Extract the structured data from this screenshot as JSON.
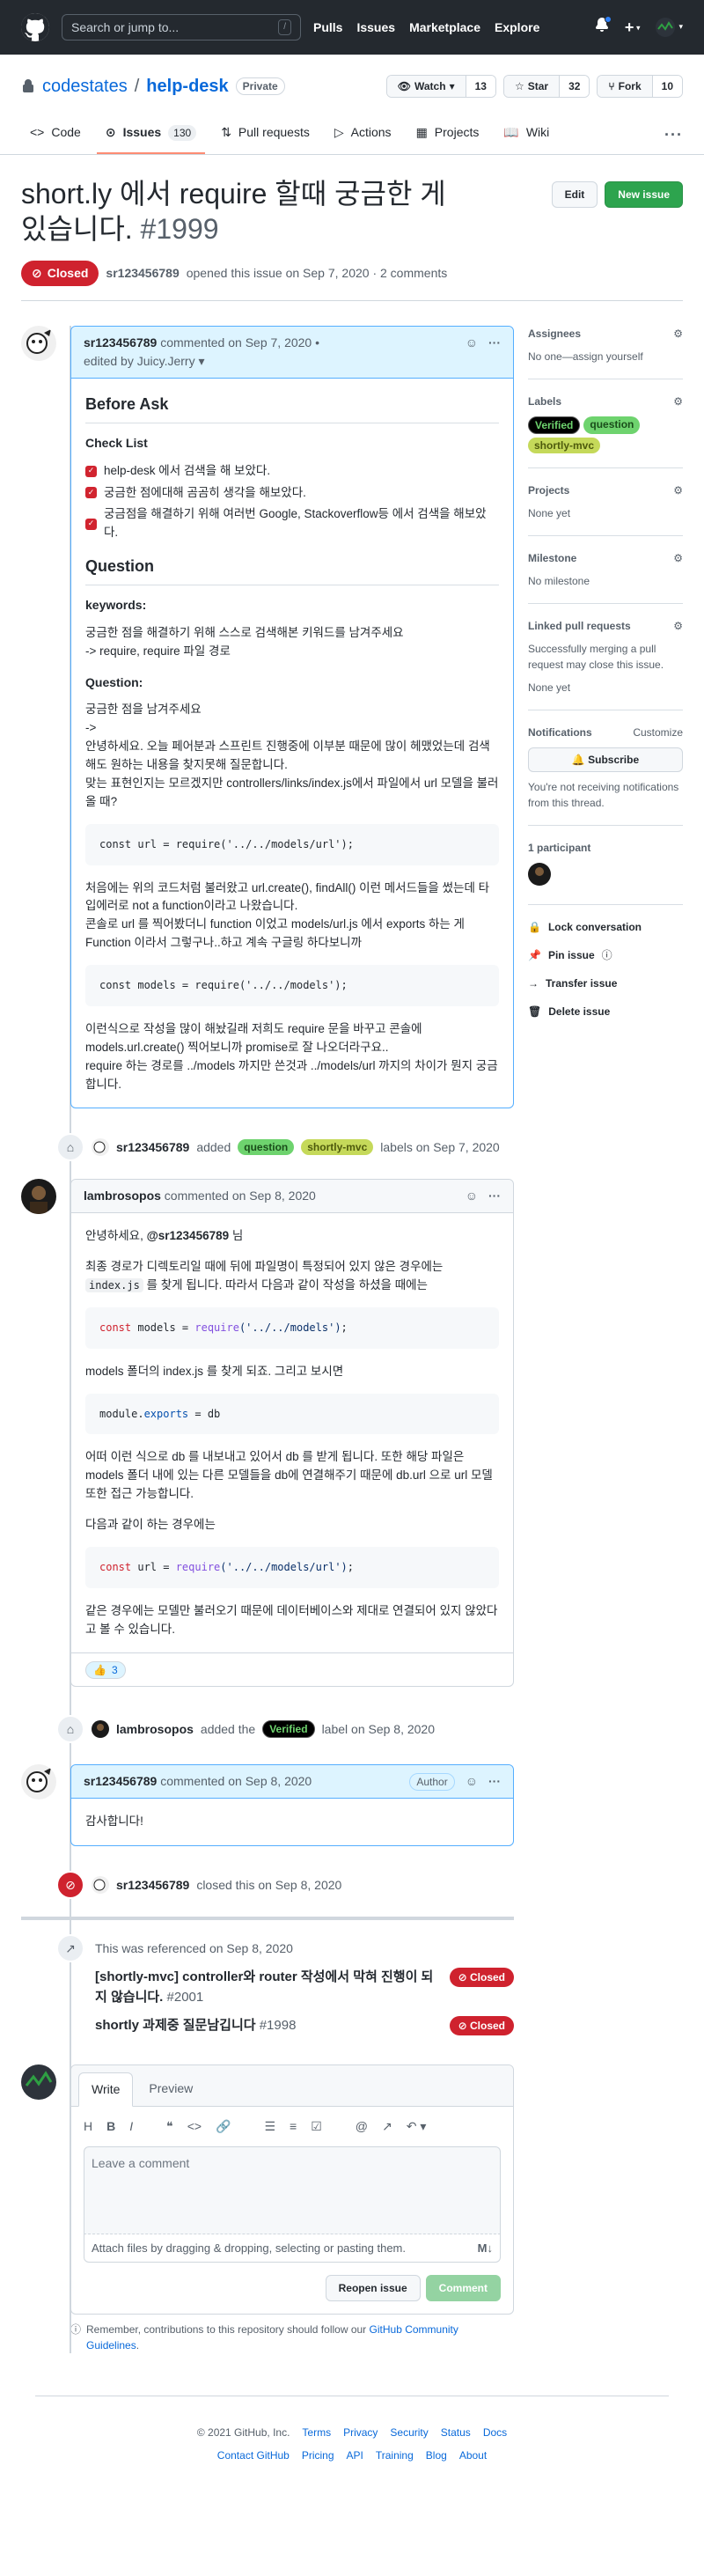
{
  "header": {
    "search_placeholder": "Search or jump to...",
    "search_key": "/",
    "nav": [
      "Pulls",
      "Issues",
      "Marketplace",
      "Explore"
    ]
  },
  "repo": {
    "owner": "codestates",
    "separator": "/",
    "name": "help-desk",
    "visibility": "Private",
    "watch_label": "Watch",
    "watch_count": "13",
    "star_label": "Star",
    "star_count": "32",
    "fork_label": "Fork",
    "fork_count": "10",
    "tabs": [
      {
        "label": "Code"
      },
      {
        "label": "Issues",
        "count": "130"
      },
      {
        "label": "Pull requests"
      },
      {
        "label": "Actions"
      },
      {
        "label": "Projects"
      },
      {
        "label": "Wiki"
      }
    ],
    "more": "···"
  },
  "issue": {
    "title": "short.ly 에서 require 할때 궁금한 게 있습니다.",
    "number": "#1999",
    "edit_label": "Edit",
    "new_issue_label": "New issue",
    "state": "Closed",
    "author": "sr123456789",
    "opened_text": "opened this issue on Sep 7, 2020 · 2 comments"
  },
  "first_comment": {
    "author": "sr123456789",
    "meta": "commented on Sep 7, 2020 •",
    "edited": "edited by Juicy.Jerry ▾",
    "h_before": "Before Ask",
    "h_checklist": "Check List",
    "tasks": [
      "help-desk 에서 검색을 해 보았다.",
      "궁금한 점에대해 곰곰히 생각을 해보았다.",
      "궁금점을 해결하기 위해 여러번 Google, Stackoverflow등 에서 검색을 해보았다."
    ],
    "h_question": "Question",
    "h_keywords": "keywords:",
    "keywords_text1": "궁금한 점을 해결하기 위해 스스로 검색해본 키워드를 남겨주세요",
    "keywords_text2": "-> require, require 파일 경로",
    "h_question2": "Question:",
    "q_text1": "궁금한 점을 남겨주세요",
    "q_text2": "->",
    "q_text3": "안녕하세요. 오늘 페어분과 스프린트 진행중에 이부분 때문에 많이 헤맸었는데 검색해도 원하는 내용을 찾지못해 질문합니다.",
    "q_text4": "맞는 표현인지는 모르겠지만 controllers/links/index.js에서 파일에서 url 모델을 불러올 때?",
    "code1": "const url = require('../../models/url');",
    "p2_1": "처음에는 위의 코드처럼 불러왔고 url.create(), findAll() 이런 메서드들을 썼는데 타입에러로 not a function이라고 나왔습니다.",
    "p2_2": "콘솔로 url 를 찍어봤더니 function 이었고 models/url.js 에서 exports 하는 게 Function 이라서 그렇구나..하고 계속 구글링 하다보니까",
    "code2": "const models = require('../../models');",
    "p3_1": "이런식으로 작성을 많이 해놨길래 저희도 require 문을 바꾸고 콘솔에 models.url.create() 찍어보니까 promise로 잘 나오더라구요..",
    "p3_2": "require 하는 경로를 ../models 까지만 쓴것과 ../models/url 까지의 차이가 뭔지 궁금합니다."
  },
  "label_event1": {
    "author": "sr123456789",
    "added": "added",
    "labels": [
      "question",
      "shortly-mvc"
    ],
    "suffix": "labels on Sep 7, 2020"
  },
  "second_comment": {
    "author": "lambrosopos",
    "meta": "commented on Sep 8, 2020",
    "greet_1": "안녕하세요, ",
    "greet_mention": "@sr123456789",
    "greet_2": " 님",
    "p1_a": "최종 경로가 디렉토리일 때에 뒤에 파일명이 특정되어 있지 않은 경우에는 ",
    "p1_code": "index.js",
    "p1_b": " 를 찾게 됩니다. 따라서 다음과 같이 작성을 하셨을 때에는",
    "code1_kw": "const",
    "code1_rest": " models = ",
    "code1_fn": "require",
    "code1_str": "('../../models')",
    "code1_end": ";",
    "p2": "models 폴더의 index.js 를 찾게 되죠. 그리고 보시면",
    "code2_a": "module.",
    "code2_kw": "exports",
    "code2_b": " = db",
    "p3": "어떠 이런 식으로 db 를 내보내고 있어서 db 를 받게 됩니다. 또한 해당 파일은 models 폴더 내에 있는 다른 모델들을 db에 연결해주기 때문에 db.url 으로 url 모델 또한 접근 가능합니다.",
    "p4": "다음과 같이 하는 경우에는",
    "code3_kw": "const",
    "code3_rest": " url = ",
    "code3_fn": "require",
    "code3_str": "('../../models/url')",
    "code3_end": ";",
    "p5": "같은 경우에는 모델만 불러오기 때문에 데이터베이스와 제대로 연결되어 있지 않았다고 볼 수 있습니다.",
    "reaction_emoji": "👍",
    "reaction_count": "3"
  },
  "label_event2": {
    "author": "lambrosopos",
    "prefix": "added the",
    "label": "Verified",
    "suffix": "label on Sep 8, 2020"
  },
  "third_comment": {
    "author": "sr123456789",
    "meta": "commented on Sep 8, 2020",
    "badge": "Author",
    "body": "감사합니다!"
  },
  "close_event": {
    "author": "sr123456789",
    "text": "closed this on Sep 8, 2020"
  },
  "references": {
    "title": "This was referenced on Sep 8, 2020",
    "items": [
      {
        "title": "[shortly-mvc] controller와 router 작성에서 막혀 진행이 되지 않습니다.",
        "num": "#2001",
        "state": "Closed"
      },
      {
        "title": "shortly 과제중 질문남깁니다",
        "num": "#1998",
        "state": "Closed"
      }
    ]
  },
  "new_comment": {
    "tab_write": "Write",
    "tab_preview": "Preview",
    "placeholder": "Leave a comment",
    "attach_text": "Attach files by dragging & dropping, selecting or pasting them.",
    "md_badge": "M↓",
    "reopen_label": "Reopen issue",
    "comment_label": "Comment",
    "tip_text": "Remember, contributions to this repository should follow our ",
    "tip_link": "GitHub Community Guidelines",
    "tip_end": "."
  },
  "sidebar": {
    "assignees_title": "Assignees",
    "assignees_text": "No one—assign yourself",
    "labels_title": "Labels",
    "labels": [
      "Verified",
      "question",
      "shortly-mvc"
    ],
    "projects_title": "Projects",
    "projects_text": "None yet",
    "milestone_title": "Milestone",
    "milestone_text": "No milestone",
    "linked_title": "Linked pull requests",
    "linked_text": "Successfully merging a pull request may close this issue.",
    "linked_none": "None yet",
    "notifications_title": "Notifications",
    "customize": "Customize",
    "subscribe_label": "Subscribe",
    "notif_text": "You're not receiving notifications from this thread.",
    "participants": "1 participant",
    "lock": "Lock conversation",
    "pin": "Pin issue",
    "transfer": "Transfer issue",
    "delete": "Delete issue"
  },
  "footer": {
    "copyright": "© 2021 GitHub, Inc.",
    "links1": [
      "Terms",
      "Privacy",
      "Security",
      "Status",
      "Docs"
    ],
    "links2": [
      "Contact GitHub",
      "Pricing",
      "API",
      "Training",
      "Blog",
      "About"
    ]
  }
}
